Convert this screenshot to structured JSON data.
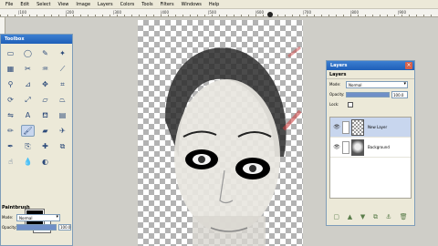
{
  "menubar": {
    "items": [
      "File",
      "Edit",
      "Select",
      "View",
      "Image",
      "Layers",
      "Colors",
      "Tools",
      "Filters",
      "Windows",
      "Help"
    ]
  },
  "ruler": {
    "labels": [
      "|100",
      "|200",
      "|300",
      "|400",
      "|500",
      "|600",
      "|700",
      "|800",
      "|900"
    ]
  },
  "toolbox": {
    "title": "Toolbox",
    "tools": [
      {
        "icon": "rect-select-icon",
        "glyph": "▭",
        "active": false
      },
      {
        "icon": "ellipse-select-icon",
        "glyph": "◯",
        "active": false
      },
      {
        "icon": "free-select-icon",
        "glyph": "✎",
        "active": false
      },
      {
        "icon": "fuzzy-select-icon",
        "glyph": "✦",
        "active": false
      },
      {
        "icon": "color-select-icon",
        "glyph": "▦",
        "active": false
      },
      {
        "icon": "scissors-icon",
        "glyph": "✂",
        "active": false
      },
      {
        "icon": "paths-icon",
        "glyph": "♒",
        "active": false
      },
      {
        "icon": "color-picker-icon",
        "glyph": "⟋",
        "active": false
      },
      {
        "icon": "zoom-icon",
        "glyph": "⚲",
        "active": false
      },
      {
        "icon": "measure-icon",
        "glyph": "⊿",
        "active": false
      },
      {
        "icon": "move-icon",
        "glyph": "✥",
        "active": false
      },
      {
        "icon": "crop-icon",
        "glyph": "⌗",
        "active": false
      },
      {
        "icon": "rotate-icon",
        "glyph": "⟳",
        "active": false
      },
      {
        "icon": "scale-icon",
        "glyph": "⤢",
        "active": false
      },
      {
        "icon": "shear-icon",
        "glyph": "▱",
        "active": false
      },
      {
        "icon": "perspective-icon",
        "glyph": "⏢",
        "active": false
      },
      {
        "icon": "flip-icon",
        "glyph": "⇋",
        "active": false
      },
      {
        "icon": "text-icon",
        "glyph": "A",
        "active": false
      },
      {
        "icon": "bucket-fill-icon",
        "glyph": "⛾",
        "active": false
      },
      {
        "icon": "blend-icon",
        "glyph": "▤",
        "active": false
      },
      {
        "icon": "pencil-icon",
        "glyph": "✏",
        "active": false
      },
      {
        "icon": "paintbrush-icon",
        "glyph": "🖌",
        "active": true
      },
      {
        "icon": "eraser-icon",
        "glyph": "▰",
        "active": false
      },
      {
        "icon": "airbrush-icon",
        "glyph": "✈",
        "active": false
      },
      {
        "icon": "ink-icon",
        "glyph": "✒",
        "active": false
      },
      {
        "icon": "clone-icon",
        "glyph": "⎘",
        "active": false
      },
      {
        "icon": "heal-icon",
        "glyph": "✚",
        "active": false
      },
      {
        "icon": "perspective-clone-icon",
        "glyph": "⧉",
        "active": false
      },
      {
        "icon": "smudge-icon",
        "glyph": "☝",
        "active": false
      },
      {
        "icon": "blur-icon",
        "glyph": "💧",
        "active": false
      },
      {
        "icon": "dodge-burn-icon",
        "glyph": "◐",
        "active": false
      }
    ],
    "options": {
      "title": "Paintbrush",
      "mode_label": "Mode:",
      "mode_value": "Normal",
      "opacity_label": "Opacity:",
      "opacity_value": "100.0",
      "brush_label": "Brush:",
      "brush_value": "Circle (11)"
    }
  },
  "layers": {
    "title": "Layers",
    "header": "Layers",
    "mode_label": "Mode:",
    "mode_value": "Normal",
    "opacity_label": "Opacity:",
    "opacity_value": "100.0",
    "lock_label": "Lock:",
    "items": [
      {
        "name": "New Layer",
        "visible": true,
        "selected": true,
        "thumb": "checker"
      },
      {
        "name": "Background",
        "visible": true,
        "selected": false,
        "thumb": "face"
      }
    ]
  }
}
